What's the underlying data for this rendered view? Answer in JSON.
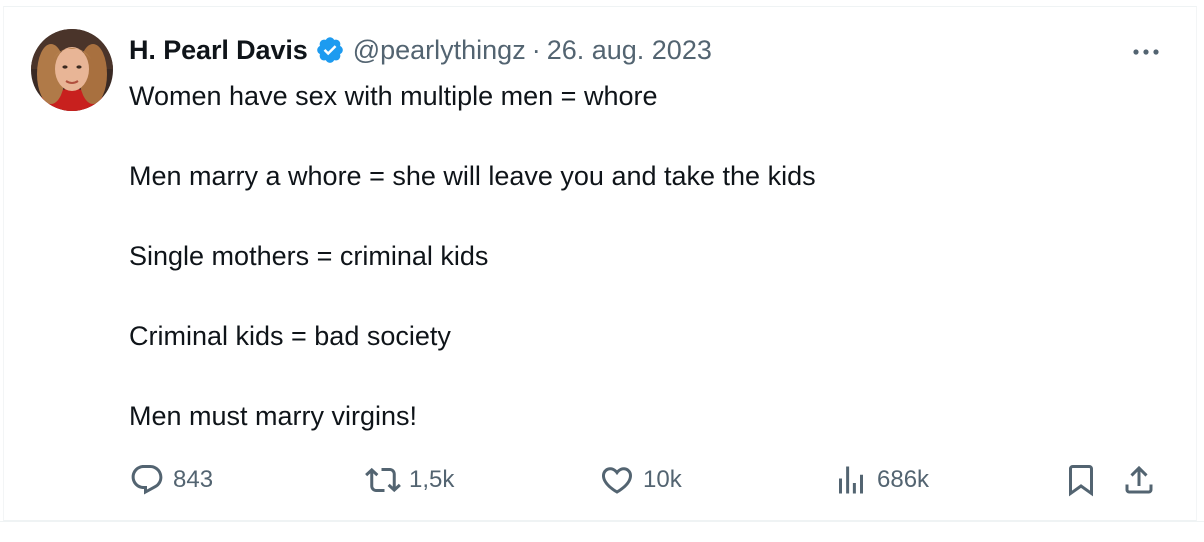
{
  "tweet": {
    "author": {
      "display_name": "H. Pearl Davis",
      "handle": "@pearlythingz",
      "verified": true
    },
    "separator": "·",
    "date": "26. aug. 2023",
    "text_lines": [
      "Women have sex with multiple men = whore",
      "Men marry a whore = she will leave you and take the kids",
      "Single mothers = criminal kids",
      "Criminal kids = bad society",
      "Men must marry virgins!"
    ],
    "stats": {
      "replies": "843",
      "reposts": "1,5k",
      "likes": "10k",
      "views": "686k"
    }
  },
  "colors": {
    "text": "#0f1419",
    "secondary": "#536471",
    "verified": "#1d9bf0",
    "border": "#eff3f4"
  },
  "icons": [
    "verified-badge-icon",
    "more-icon",
    "reply-icon",
    "repost-icon",
    "like-icon",
    "views-icon",
    "bookmark-icon",
    "share-icon"
  ]
}
